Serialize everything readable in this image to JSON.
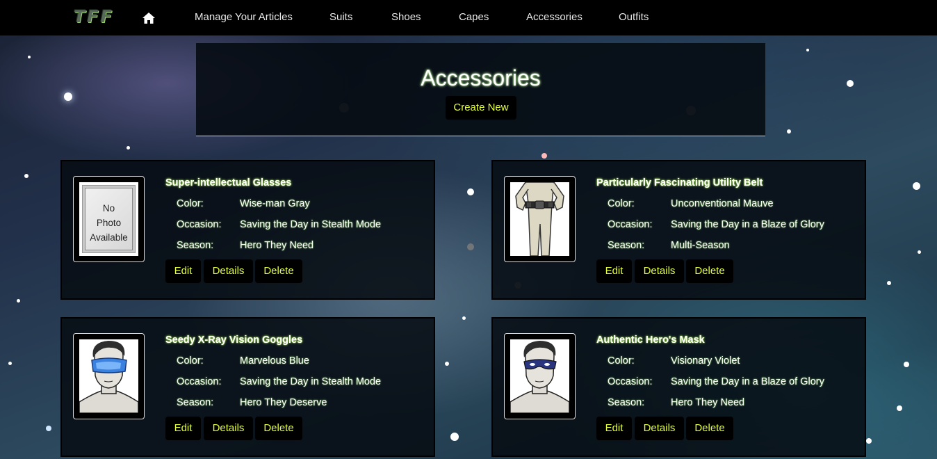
{
  "navbar": {
    "brand": "TFF",
    "home_icon": "home-icon",
    "links": [
      "Manage Your Articles",
      "Suits",
      "Shoes",
      "Capes",
      "Accessories",
      "Outfits"
    ]
  },
  "header": {
    "title": "Accessories",
    "create_label": "Create New"
  },
  "labels": {
    "color": "Color:",
    "occasion": "Occasion:",
    "season": "Season:",
    "edit": "Edit",
    "details": "Details",
    "delete": "Delete"
  },
  "items": [
    {
      "name": "Super-intellectual Glasses",
      "color": "Wise-man Gray",
      "occasion": "Saving the Day in Stealth Mode",
      "season": "Hero They Need",
      "image": "no-photo",
      "no_photo_text": [
        "No",
        "Photo",
        "Available"
      ]
    },
    {
      "name": "Particularly Fascinating Utility Belt",
      "color": "Unconventional Mauve",
      "occasion": "Saving the Day in a Blaze of Glory",
      "season": "Multi-Season",
      "image": "utility-belt"
    },
    {
      "name": "Seedy X-Ray Vision Goggles",
      "color": "Marvelous Blue",
      "occasion": "Saving the Day in Stealth Mode",
      "season": "Hero They Deserve",
      "image": "goggles"
    },
    {
      "name": "Authentic Hero's Mask",
      "color": "Visionary Violet",
      "occasion": "Saving the Day in a Blaze of Glory",
      "season": "Hero They Need",
      "image": "mask"
    }
  ],
  "colors": {
    "accent": "#e6ff3a",
    "navbar_bg": "#000000",
    "glow": "#b6ff5a"
  }
}
